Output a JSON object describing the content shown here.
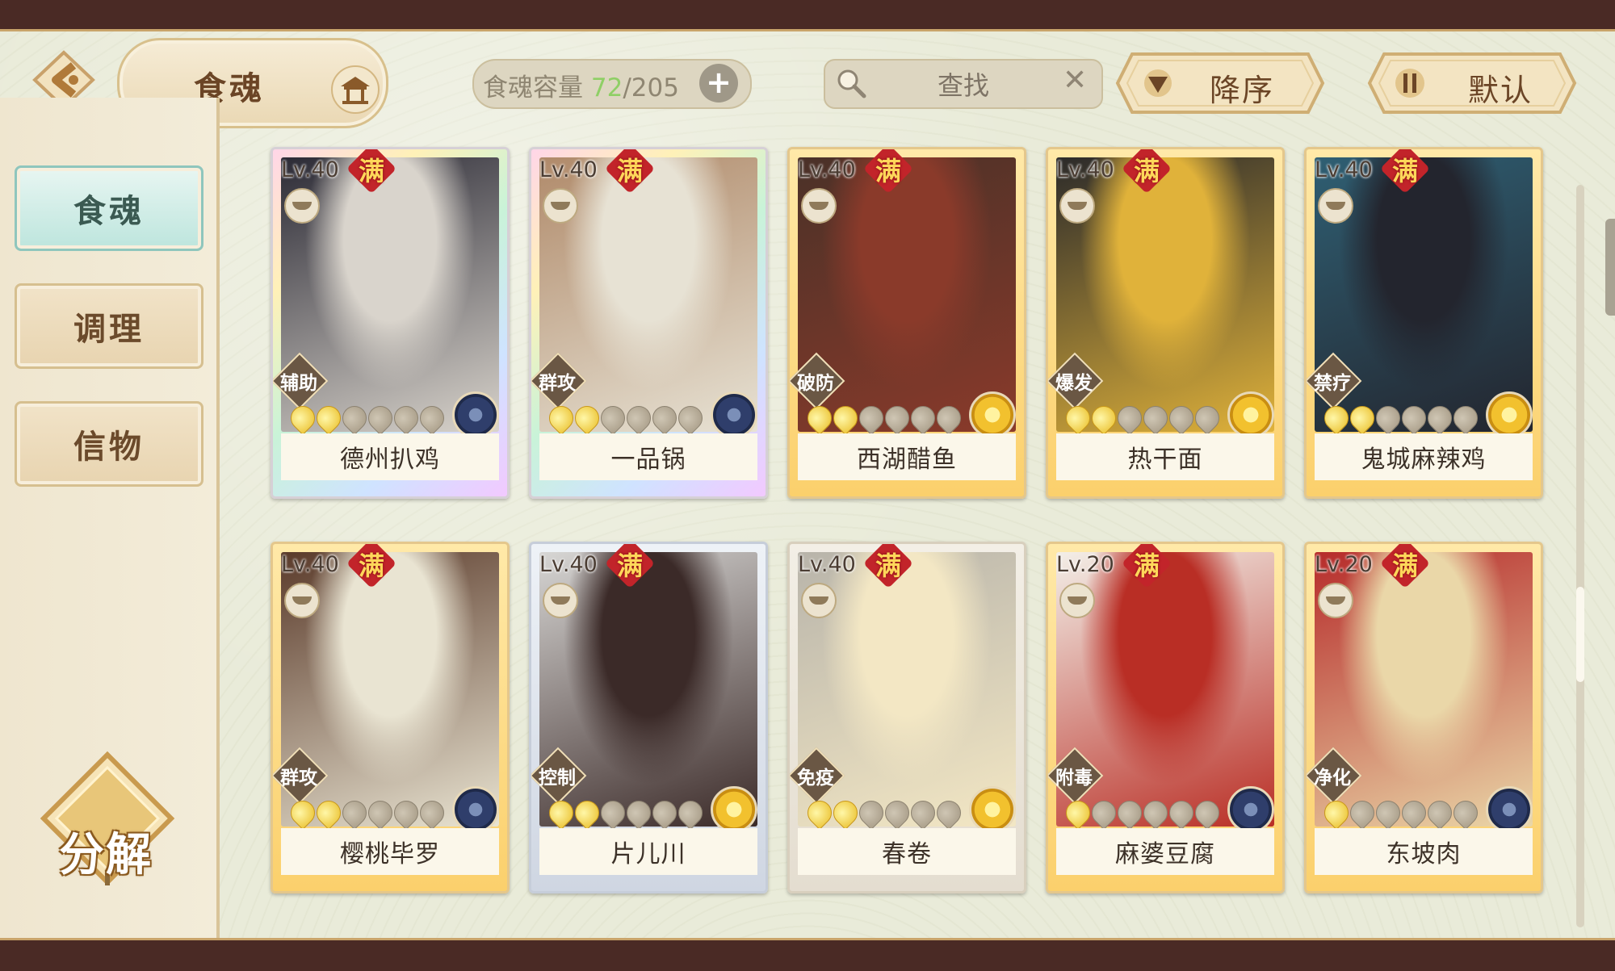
{
  "header": {
    "title": "食魂",
    "capacity_label": "食魂容量",
    "capacity_current": "72",
    "capacity_sep": "/",
    "capacity_max": "205",
    "add_symbol": "+",
    "search_placeholder": "查找",
    "clear_symbol": "✕",
    "sort_order_label": "降序",
    "sort_mode_label": "默认"
  },
  "sidebar": {
    "tabs": [
      {
        "label": "食魂",
        "active": true
      },
      {
        "label": "调理",
        "active": false
      },
      {
        "label": "信物",
        "active": false
      }
    ],
    "decompose_label": "分解"
  },
  "cards": [
    {
      "name": "德州扒鸡",
      "level": "Lv.40",
      "full": "满",
      "role": "辅助",
      "frame": "rainbow",
      "stars_on": 2,
      "stars_total": 6,
      "element": "blue",
      "colors": [
        "#2b2a35",
        "#d9d4cc"
      ]
    },
    {
      "name": "一品锅",
      "level": "Lv.40",
      "full": "满",
      "role": "群攻",
      "frame": "rainbow",
      "stars_on": 2,
      "stars_total": 6,
      "element": "blue",
      "colors": [
        "#b08a6a",
        "#e7e2d4"
      ]
    },
    {
      "name": "西湖醋鱼",
      "level": "Lv.40",
      "full": "满",
      "role": "破防",
      "frame": "gold",
      "stars_on": 2,
      "stars_total": 6,
      "element": "yellow",
      "colors": [
        "#4a3128",
        "#8a3a2a"
      ]
    },
    {
      "name": "热干面",
      "level": "Lv.40",
      "full": "满",
      "role": "爆发",
      "frame": "gold",
      "stars_on": 2,
      "stars_total": 6,
      "element": "yellow",
      "colors": [
        "#2b2a2a",
        "#e0b23a"
      ]
    },
    {
      "name": "鬼城麻辣鸡",
      "level": "Lv.40",
      "full": "满",
      "role": "禁疗",
      "frame": "gold",
      "stars_on": 2,
      "stars_total": 6,
      "element": "yellow",
      "colors": [
        "#2f5f73",
        "#23252e"
      ]
    },
    {
      "name": "樱桃毕罗",
      "level": "Lv.40",
      "full": "满",
      "role": "群攻",
      "frame": "gold",
      "stars_on": 2,
      "stars_total": 6,
      "element": "blue",
      "colors": [
        "#5a3a2a",
        "#e9e4d2"
      ]
    },
    {
      "name": "片儿川",
      "level": "Lv.40",
      "full": "满",
      "role": "控制",
      "frame": "silver",
      "stars_on": 2,
      "stars_total": 6,
      "element": "yellow",
      "colors": [
        "#d7d6d4",
        "#3b2a28"
      ]
    },
    {
      "name": "春卷",
      "level": "Lv.40",
      "full": "满",
      "role": "免疫",
      "frame": "plain",
      "stars_on": 2,
      "stars_total": 6,
      "element": "yellow",
      "colors": [
        "#b8b4aa",
        "#f3e7c4"
      ]
    },
    {
      "name": "麻婆豆腐",
      "level": "Lv.20",
      "full": "满",
      "role": "附毒",
      "frame": "gold",
      "stars_on": 1,
      "stars_total": 6,
      "element": "blue",
      "colors": [
        "#f3efe8",
        "#b92e25"
      ]
    },
    {
      "name": "东坡肉",
      "level": "Lv.20",
      "full": "满",
      "role": "净化",
      "frame": "gold",
      "stars_on": 1,
      "stars_total": 6,
      "element": "blue",
      "colors": [
        "#b62b2a",
        "#ead7a8"
      ]
    }
  ]
}
